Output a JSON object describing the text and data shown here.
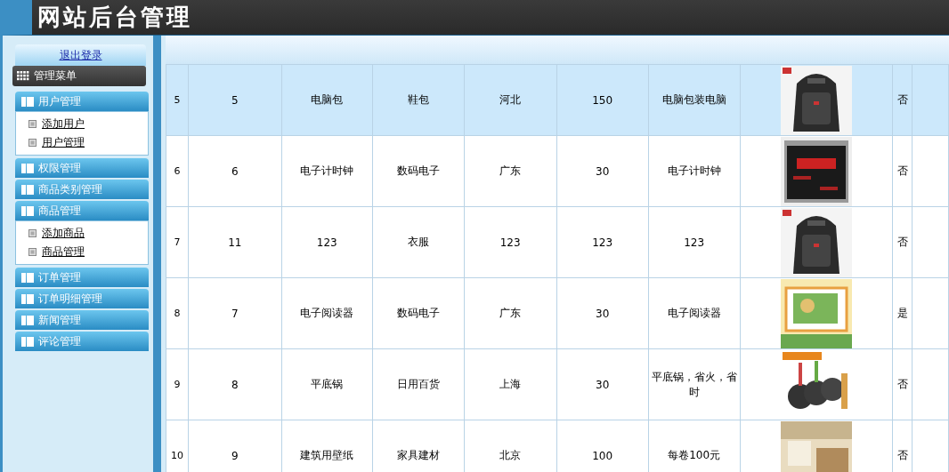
{
  "header": {
    "title": "网站后台管理"
  },
  "sidebar": {
    "logout": "退出登录",
    "menu_title": "管理菜单",
    "groups": [
      {
        "label": "用户管理",
        "children": [
          {
            "label": "添加用户"
          },
          {
            "label": "用户管理"
          }
        ]
      },
      {
        "label": "权限管理"
      },
      {
        "label": "商品类别管理"
      },
      {
        "label": "商品管理",
        "children": [
          {
            "label": "添加商品"
          },
          {
            "label": "商品管理"
          }
        ]
      },
      {
        "label": "订单管理"
      },
      {
        "label": "订单明细管理"
      },
      {
        "label": "新闻管理"
      },
      {
        "label": "评论管理"
      }
    ]
  },
  "table": {
    "rows": [
      {
        "selected": true,
        "cells": [
          "5",
          "5",
          "电脑包",
          "鞋包",
          "河北",
          "150",
          "电脑包装电脑"
        ],
        "image": {
          "kind": "picture"
        },
        "flag": "否"
      },
      {
        "selected": false,
        "cells": [
          "6",
          "6",
          "电子计时钟",
          "数码电子",
          "广东",
          "30",
          "电子计时钟"
        ],
        "image": {
          "kind": "picture"
        },
        "flag": "否"
      },
      {
        "selected": false,
        "cells": [
          "7",
          "11",
          "123",
          "衣服",
          "123",
          "123",
          "123"
        ],
        "image": {
          "kind": "picture"
        },
        "flag": "否"
      },
      {
        "selected": false,
        "cells": [
          "8",
          "7",
          "电子阅读器",
          "数码电子",
          "广东",
          "30",
          "电子阅读器"
        ],
        "image": {
          "kind": "picture"
        },
        "flag": "是"
      },
      {
        "selected": false,
        "cells": [
          "9",
          "8",
          "平底锅",
          "日用百货",
          "上海",
          "30",
          "平底锅，省火，省时"
        ],
        "image": {
          "kind": "picture"
        },
        "flag": "否"
      },
      {
        "selected": false,
        "cells": [
          "10",
          "9",
          "建筑用壁纸",
          "家具建材",
          "北京",
          "100",
          "每卷100元"
        ],
        "image": {
          "kind": "picture"
        },
        "flag": "否"
      }
    ]
  }
}
